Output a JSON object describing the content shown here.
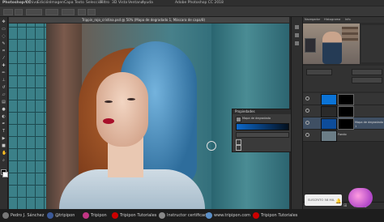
{
  "menubar": {
    "app_title": "Photoshop CC",
    "items": [
      "Archivo",
      "Edición",
      "Imagen",
      "Capa",
      "Texto",
      "Selección",
      "Filtro",
      "3D",
      "Vista",
      "Ventana",
      "Ayuda"
    ],
    "window_title": "Adobe Photoshop CC 2018"
  },
  "document": {
    "tab_label": "Trippin_rojo_cristina.psd @ 50% (Mapa de degradado 1, Máscara de capa/8)"
  },
  "properties_panel": {
    "title": "Propiedades",
    "subtitle": "Mapa de degradado"
  },
  "right_panel": {
    "tabs": [
      "Navegador",
      "Histograma",
      "Info"
    ],
    "layers": [
      {
        "name": "",
        "thumb_color": "#0b73d6",
        "has_mask": true,
        "selected": false
      },
      {
        "name": "",
        "thumb_color": "#2a2a2a",
        "has_mask": true,
        "selected": false
      },
      {
        "name": "Mapa de degradado 1",
        "thumb_color": "#0d4c9a",
        "has_mask": true,
        "selected": true
      },
      {
        "name": "Fondo",
        "thumb_color": "#6b7d86",
        "has_mask": false,
        "selected": false
      }
    ]
  },
  "footer": {
    "author": "Pedro J. Sánchez",
    "handle": "@tripipon",
    "instagram": "Tripipon",
    "youtube": "Tripipon Tutoriales",
    "badge": "Instructor certificado",
    "website": "www.tripipon.com",
    "channel": "Tripipon Tutoriales"
  },
  "subscribe": {
    "label": "SUSCRITO 58 MIL"
  },
  "colors": {
    "selected_layer": "#3f4f63",
    "accent_blue": "#0b73d6"
  }
}
